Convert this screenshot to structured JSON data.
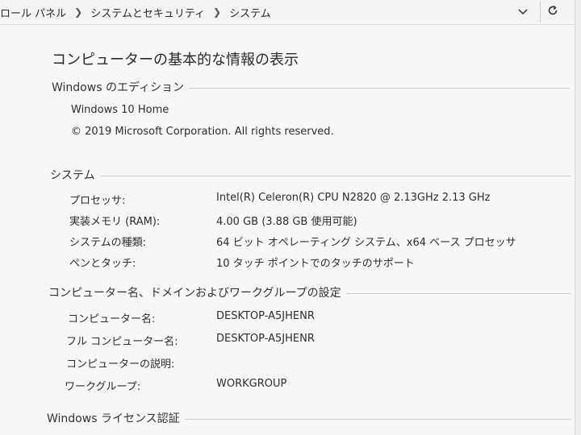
{
  "address_bar": {
    "breadcrumbs": [
      "ロール パネル",
      "システムとセキュリティ",
      "システム"
    ],
    "dropdown_icon": "chevron-down-icon",
    "refresh_icon": "refresh-icon"
  },
  "page_title": "コンピューターの基本的な情報の表示",
  "edition": {
    "header": "Windows のエディション",
    "name": "Windows 10 Home",
    "copyright": "© 2019 Microsoft Corporation. All rights reserved."
  },
  "system": {
    "header": "システム",
    "rows": [
      {
        "key": "プロセッサ:",
        "value": "Intel(R) Celeron(R) CPU  N2820  @ 2.13GHz   2.13 GHz"
      },
      {
        "key": "実装メモリ (RAM):",
        "value": "4.00 GB (3.88 GB 使用可能)"
      },
      {
        "key": "システムの種類:",
        "value": "64 ビット オペレーティング システム、x64 ベース プロセッサ"
      },
      {
        "key": "ペンとタッチ:",
        "value": "10 タッチ ポイントでのタッチのサポート"
      }
    ]
  },
  "computer_name": {
    "header": "コンピューター名、ドメインおよびワークグループの設定",
    "rows": [
      {
        "key": "コンピューター名:",
        "value": "DESKTOP-A5JHENR"
      },
      {
        "key": "フル コンピューター名:",
        "value": "DESKTOP-A5JHENR"
      },
      {
        "key": "コンピューターの説明:",
        "value": ""
      },
      {
        "key": "ワークグループ:",
        "value": "WORKGROUP"
      }
    ]
  },
  "license": {
    "header": "Windows ライセンス認証"
  }
}
